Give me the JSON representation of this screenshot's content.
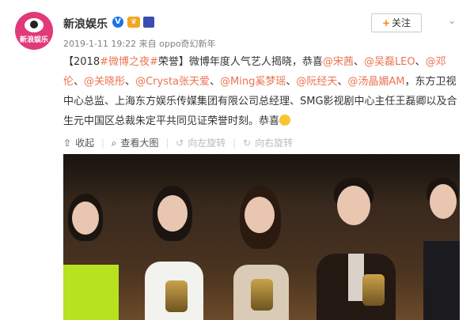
{
  "account": {
    "name": "新浪娱乐",
    "avatar_text": "新浪娱乐",
    "verified_icon": "verified-v-icon",
    "badge_icons": [
      "vip-badge-icon",
      "member-badge-icon"
    ]
  },
  "header": {
    "follow_label": "关注",
    "menu_icon": "chevron-down-icon"
  },
  "meta": {
    "time": "2019-1-11 19:22",
    "source_prefix": "来自",
    "source": "oppo奇幻新年"
  },
  "post": {
    "p1": "【2018",
    "topic": "#微博之夜#",
    "p2": "荣誉】微博年度人气艺人揭晓，恭喜",
    "m1": "@宋茜",
    "sep1": "、",
    "m2": "@吴磊LEO",
    "sep2": "、",
    "m3": "@邓伦",
    "sep3": "、",
    "m4": "@关晓彤",
    "sep4": "、",
    "m5": "@Crysta张天爱",
    "sep5": "、",
    "m6": "@Ming奚梦瑶",
    "sep6": "、",
    "m7": "@阮经天",
    "sep7": "、",
    "m8": "@汤晶媚AM",
    "p3": "，东方卫视中心总监、上海东方娱乐传媒集团有限公司总经理、SMG影视剧中心主任王磊卿以及合生元中国区总裁朱定平共同见证荣誉时刻。恭喜",
    "emoji": "smile-emoji-icon"
  },
  "actions": {
    "collapse": "收起",
    "view_large": "查看大图",
    "rotate_left": "向左旋转",
    "rotate_right": "向右旋转",
    "sep": "|"
  }
}
